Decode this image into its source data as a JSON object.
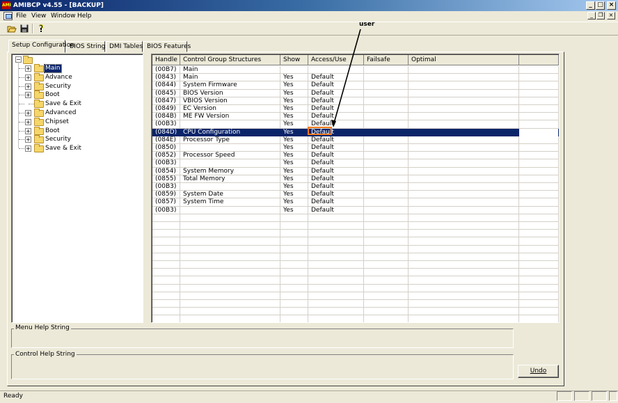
{
  "window": {
    "title": "AMIBCP v4.55 - [BACKUP]",
    "icon_text": "AMI",
    "controls": [
      "minimize-icon",
      "maximize-icon",
      "close-icon"
    ],
    "mdi_controls": [
      "minimize-icon",
      "restore-icon",
      "close-icon"
    ]
  },
  "menu": {
    "items": [
      "File",
      "View",
      "Window",
      "Help"
    ]
  },
  "toolbar": {
    "buttons": [
      "open-folder-icon",
      "save-icon",
      "help-icon"
    ]
  },
  "tabs": [
    {
      "label": "Setup Configuration",
      "active": true
    },
    {
      "label": "BIOS Strings",
      "active": false
    },
    {
      "label": "DMI Tables",
      "active": false
    },
    {
      "label": "BIOS Features",
      "active": false
    }
  ],
  "tree": {
    "items": [
      {
        "label": "Main",
        "expandable": true,
        "selected": true
      },
      {
        "label": "Advance",
        "expandable": true
      },
      {
        "label": "Security",
        "expandable": true
      },
      {
        "label": "Boot",
        "expandable": true
      },
      {
        "label": "Save & Exit",
        "expandable": false
      },
      {
        "label": "Advanced",
        "expandable": true
      },
      {
        "label": "Chipset",
        "expandable": true
      },
      {
        "label": "Boot",
        "expandable": true
      },
      {
        "label": "Security",
        "expandable": true
      },
      {
        "label": "Save & Exit",
        "expandable": true
      }
    ]
  },
  "grid": {
    "columns": [
      "Handle",
      "Control Group Structures",
      "Show",
      "Access/Use",
      "Failsafe",
      "Optimal"
    ],
    "rows": [
      [
        "(00B7)",
        "Main",
        "",
        "",
        "",
        ""
      ],
      [
        "(0843)",
        "Main",
        "Yes",
        "Default",
        "",
        ""
      ],
      [
        "(0844)",
        "System Firmware",
        "Yes",
        "Default",
        "",
        ""
      ],
      [
        "(0845)",
        "BIOS Version",
        "Yes",
        "Default",
        "",
        ""
      ],
      [
        "(0847)",
        "VBIOS Version",
        "Yes",
        "Default",
        "",
        ""
      ],
      [
        "(0849)",
        "EC Version",
        "Yes",
        "Default",
        "",
        ""
      ],
      [
        "(084B)",
        "ME FW Version",
        "Yes",
        "Default",
        "",
        ""
      ],
      [
        "(00B3)",
        "",
        "Yes",
        "Default",
        "",
        ""
      ],
      [
        "(084D)",
        "CPU Configuration",
        "Yes",
        "Default",
        "",
        ""
      ],
      [
        "(084E)",
        "Processor Type",
        "Yes",
        "Default",
        "",
        ""
      ],
      [
        "(0850)",
        "",
        "Yes",
        "Default",
        "",
        ""
      ],
      [
        "(0852)",
        "Processor Speed",
        "Yes",
        "Default",
        "",
        ""
      ],
      [
        "(00B3)",
        "",
        "Yes",
        "Default",
        "",
        ""
      ],
      [
        "(0854)",
        "System Memory",
        "Yes",
        "Default",
        "",
        ""
      ],
      [
        "(0855)",
        "Total Memory",
        "Yes",
        "Default",
        "",
        ""
      ],
      [
        "(00B3)",
        "",
        "Yes",
        "Default",
        "",
        ""
      ],
      [
        "(0859)",
        "System Date",
        "Yes",
        "Default",
        "",
        ""
      ],
      [
        "(0857)",
        "System Time",
        "Yes",
        "Default",
        "",
        ""
      ],
      [
        "(00B3)",
        "",
        "Yes",
        "Default",
        "",
        ""
      ]
    ],
    "selected_row": 8
  },
  "menu_help": {
    "label": "Menu Help String"
  },
  "control_help": {
    "label": "Control Help String"
  },
  "undo": {
    "label": "Undo"
  },
  "status": {
    "text": "Ready"
  },
  "annotation": {
    "label": "user",
    "color": "#f07a20"
  }
}
